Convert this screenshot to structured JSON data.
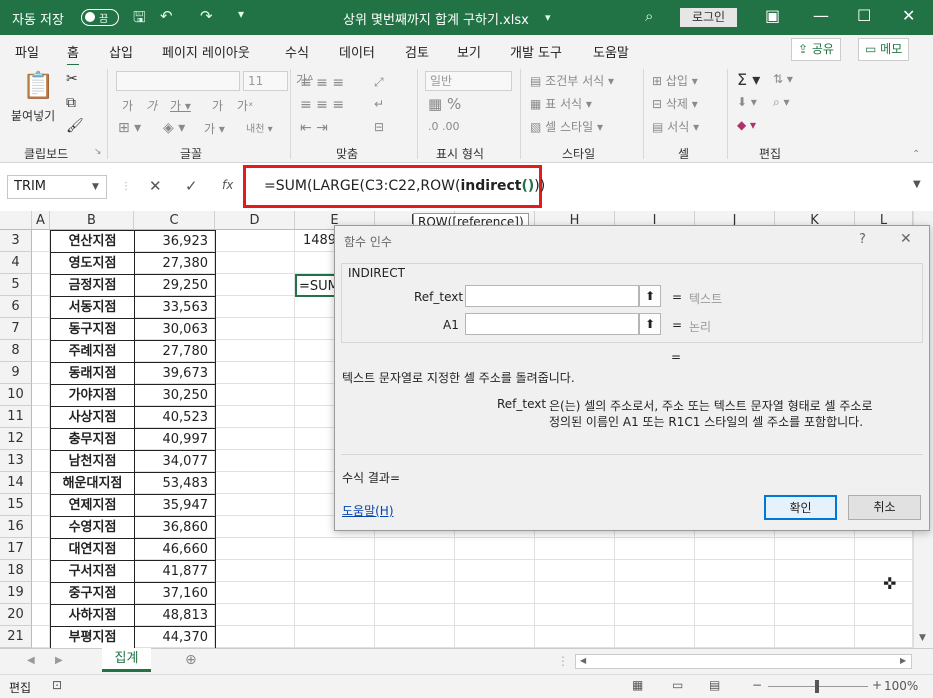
{
  "title_bar": {
    "autosave_label": "자동 저장",
    "toggle_state": "끔",
    "file_title": "상위 몇번째까지 합계 구하기.xlsx",
    "login": "로그인"
  },
  "ribbon_tabs": [
    "파일",
    "홈",
    "삽입",
    "페이지 레이아웃",
    "수식",
    "데이터",
    "검토",
    "보기",
    "개발 도구",
    "도움말"
  ],
  "share_label": "공유",
  "memo_label": "메모",
  "ribbon": {
    "clipboard": "클립보드",
    "paste": "붙여넣기",
    "font": "글꼴",
    "font_size": "11",
    "alignment": "맞춤",
    "number": "표시 형식",
    "number_format": "일반",
    "styles": "스타일",
    "cond_format": "조건부 서식",
    "table_format": "표 서식",
    "cell_style": "셀 스타일",
    "cells": "셀",
    "insert": "삽입",
    "delete": "삭제",
    "format": "서식",
    "editing": "편집"
  },
  "name_box": "TRIM",
  "formula": {
    "p1": "=SUM(LARGE(C3:C22,ROW(",
    "p2": "indirect",
    "p3": "()",
    "p4": "))"
  },
  "tooltip": "ROW([reference])",
  "columns": [
    "A",
    "B",
    "C",
    "D",
    "E",
    "F",
    "G",
    "H",
    "I",
    "J",
    "K",
    "L"
  ],
  "rows": [
    {
      "num": "3",
      "name": "연산지점",
      "value": "36,923"
    },
    {
      "num": "4",
      "name": "영도지점",
      "value": "27,380"
    },
    {
      "num": "5",
      "name": "금정지점",
      "value": "29,250"
    },
    {
      "num": "6",
      "name": "서동지점",
      "value": "33,563"
    },
    {
      "num": "7",
      "name": "동구지점",
      "value": "30,063"
    },
    {
      "num": "8",
      "name": "주례지점",
      "value": "27,780"
    },
    {
      "num": "9",
      "name": "동래지점",
      "value": "39,673"
    },
    {
      "num": "10",
      "name": "가야지점",
      "value": "30,250"
    },
    {
      "num": "11",
      "name": "사상지점",
      "value": "40,523"
    },
    {
      "num": "12",
      "name": "충무지점",
      "value": "40,997"
    },
    {
      "num": "13",
      "name": "남천지점",
      "value": "34,077"
    },
    {
      "num": "14",
      "name": "해운대지점",
      "value": "53,483"
    },
    {
      "num": "15",
      "name": "연제지점",
      "value": "35,947"
    },
    {
      "num": "16",
      "name": "수영지점",
      "value": "36,860"
    },
    {
      "num": "17",
      "name": "대연지점",
      "value": "46,660"
    },
    {
      "num": "18",
      "name": "구서지점",
      "value": "41,877"
    },
    {
      "num": "19",
      "name": "중구지점",
      "value": "37,160"
    },
    {
      "num": "20",
      "name": "사하지점",
      "value": "48,813"
    },
    {
      "num": "21",
      "name": "부평지점",
      "value": "44,370"
    }
  ],
  "e3": "1489",
  "e5": "=SUM",
  "dialog": {
    "title": "함수 인수",
    "help_q": "?",
    "function_name": "INDIRECT",
    "arg1_label": "Ref_text",
    "arg1_result": "텍스트",
    "arg2_label": "A1",
    "arg2_result": "논리",
    "eq": "=",
    "description": "텍스트 문자열로 지정한 셀 주소를 돌려줍니다.",
    "arg_desc_label": "Ref_text",
    "arg_desc_line1": "은(는) 셀의 주소로서, 주소 또는 텍스트 문자열 형태로 셀 주소로",
    "arg_desc_line2": "정의된 이름인 A1 또는 R1C1 스타일의 셀 주소를 포함합니다.",
    "result_label": "수식 결과=",
    "help_link": "도움말(H)",
    "ok": "확인",
    "cancel": "취소"
  },
  "sheet_tab": "집계",
  "status": {
    "mode": "편집",
    "zoom": "100%"
  }
}
